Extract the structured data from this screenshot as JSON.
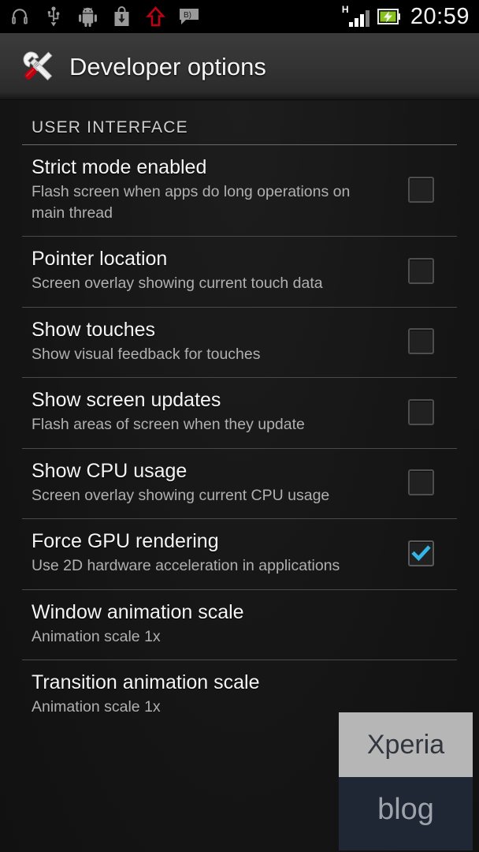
{
  "status_bar": {
    "time": "20:59",
    "network_type": "H",
    "left_icons": [
      {
        "name": "headphones-icon"
      },
      {
        "name": "usb-icon"
      },
      {
        "name": "android-robot-icon"
      },
      {
        "name": "download-bag-icon"
      },
      {
        "name": "upload-arrow-icon"
      },
      {
        "name": "sms-message-icon"
      }
    ],
    "right_icons": [
      {
        "name": "signal-bars-icon"
      },
      {
        "name": "battery-charging-icon"
      }
    ]
  },
  "title_bar": {
    "title": "Developer options",
    "icon": "wrench-screwdriver-icon"
  },
  "sections": [
    {
      "header": "USER INTERFACE",
      "rows": [
        {
          "title": "Strict mode enabled",
          "summary": "Flash screen when apps do long operations on main thread",
          "control": "checkbox",
          "checked": false
        },
        {
          "title": "Pointer location",
          "summary": "Screen overlay showing current touch data",
          "control": "checkbox",
          "checked": false
        },
        {
          "title": "Show touches",
          "summary": "Show visual feedback for touches",
          "control": "checkbox",
          "checked": false
        },
        {
          "title": "Show screen updates",
          "summary": "Flash areas of screen when they update",
          "control": "checkbox",
          "checked": false
        },
        {
          "title": "Show CPU usage",
          "summary": "Screen overlay showing current CPU usage",
          "control": "checkbox",
          "checked": false
        },
        {
          "title": "Force GPU rendering",
          "summary": "Use 2D hardware acceleration in applications",
          "control": "checkbox",
          "checked": true
        },
        {
          "title": "Window animation scale",
          "summary": "Animation scale 1x",
          "control": "none",
          "checked": false
        },
        {
          "title": "Transition animation scale",
          "summary": "Animation scale 1x",
          "control": "none",
          "checked": false
        }
      ]
    }
  ],
  "watermark": {
    "line1": "Xperia",
    "line2": "blog"
  },
  "colors": {
    "accent_check": "#33b5e5",
    "background": "#161616",
    "title_text": "#f5f5f5",
    "summary_text": "#b0b0b0",
    "watermark_top_bg": "#b6b6b6",
    "watermark_bottom_bg": "#1f2735"
  }
}
